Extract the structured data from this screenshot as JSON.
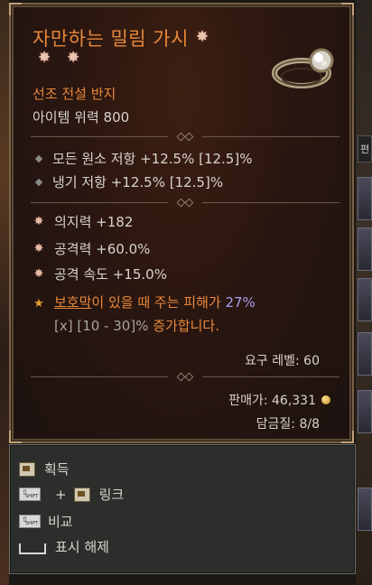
{
  "item": {
    "name": "자만하는 밀림 가시",
    "subtype": "선조 전설 반지",
    "power": "아이템 위력 800"
  },
  "implicit_stats": [
    "모든 원소 저항 +12.5% [12.5]%",
    "냉기 저항 +12.5% [12.5]%"
  ],
  "affix_stats": [
    "의지력 +182",
    "공격력 +60.0%",
    "공격 속도 +15.0%"
  ],
  "aspect": {
    "keyword": "보호막",
    "text1": "이 있을 때 주는 피해가 ",
    "value": "27%",
    "range": "[x] [10 - 30]%",
    "text2": " 증가합니다."
  },
  "requirements": {
    "level": "요구 레벨: 60"
  },
  "sell_value": "판매가: 46,331",
  "durability": "담금질: 8/8",
  "controls": {
    "acquire": "획득",
    "link": "링크",
    "compare": "비교",
    "hide": "표시 해제",
    "shift_label": "SHIFT"
  },
  "side_tab": "편",
  "colors": {
    "legendary": "#e8883a",
    "aspect_value": "#a89cf0",
    "border": "#7a6248"
  }
}
